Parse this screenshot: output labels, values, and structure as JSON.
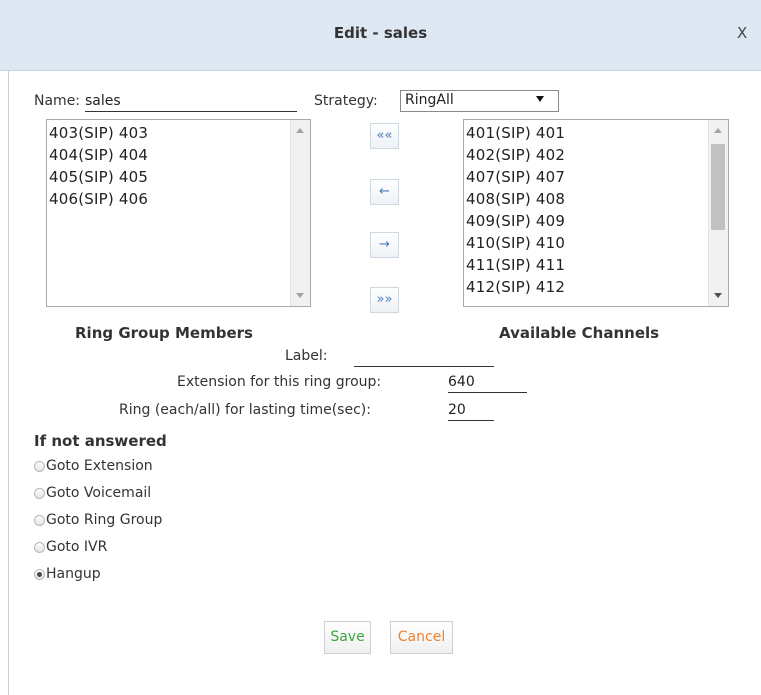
{
  "dialog": {
    "title": "Edit - sales",
    "close_label": "X"
  },
  "form": {
    "name_label": "Name:",
    "name_value": "sales",
    "strategy_label": "Strategy:",
    "strategy_value": "RingAll"
  },
  "members": {
    "caption": "Ring Group Members",
    "items": [
      "403(SIP) 403",
      "404(SIP) 404",
      "405(SIP) 405",
      "406(SIP) 406"
    ]
  },
  "available": {
    "caption": "Available Channels",
    "items": [
      "401(SIP) 401",
      "402(SIP) 402",
      "407(SIP) 407",
      "408(SIP) 408",
      "409(SIP) 409",
      "410(SIP) 410",
      "411(SIP) 411",
      "412(SIP) 412"
    ]
  },
  "move_buttons": {
    "all_left": "««",
    "left": "←",
    "right": "→",
    "all_right": "»»"
  },
  "fields": {
    "label_label": "Label:",
    "label_value": "",
    "extension_label": "Extension for this ring group:",
    "extension_value": "640",
    "ring_time_label": "Ring (each/all) for lasting time(sec):",
    "ring_time_value": "20"
  },
  "if_not_answered": {
    "heading": "If not answered",
    "options": [
      {
        "label": "Goto Extension",
        "checked": false
      },
      {
        "label": "Goto Voicemail",
        "checked": false
      },
      {
        "label": "Goto Ring Group",
        "checked": false
      },
      {
        "label": "Goto IVR",
        "checked": false
      },
      {
        "label": "Hangup",
        "checked": true
      }
    ]
  },
  "buttons": {
    "save": "Save",
    "cancel": "Cancel"
  },
  "colors": {
    "titlebar": "#dde8f3",
    "save_text": "#3aa63a",
    "cancel_text": "#f08030",
    "arrow_blue": "#4a7ab8"
  }
}
